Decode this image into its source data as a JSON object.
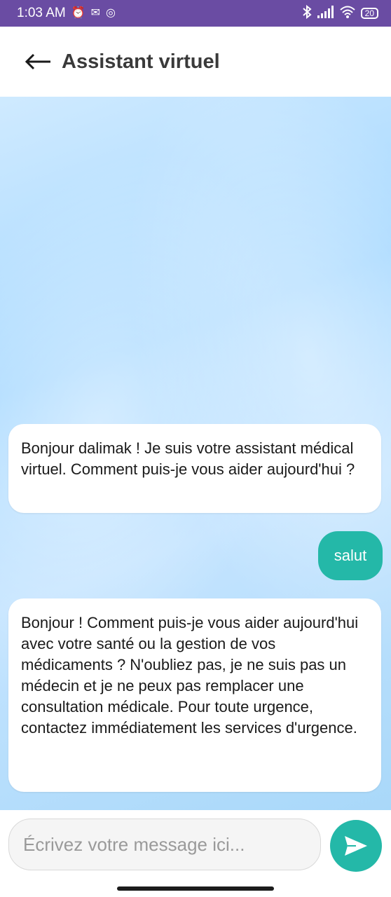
{
  "statusbar": {
    "time": "1:03 AM",
    "battery": "20"
  },
  "header": {
    "title": "Assistant virtuel"
  },
  "messages": [
    {
      "sender": "bot",
      "text": "Bonjour dalimak ! Je suis votre assistant médical virtuel. Comment puis-je vous aider aujourd'hui ?"
    },
    {
      "sender": "user",
      "text": "salut"
    },
    {
      "sender": "bot",
      "text": "Bonjour ! Comment puis-je vous aider aujourd'hui avec votre santé ou la gestion de vos médicaments ? N'oubliez pas, je ne suis pas un médecin et je ne peux pas remplacer une consultation médicale. Pour toute urgence, contactez immédiatement les services d'urgence."
    }
  ],
  "composer": {
    "placeholder": "Écrivez votre message ici..."
  },
  "colors": {
    "statusbar": "#6A4CA3",
    "accent": "#24B8A8"
  }
}
